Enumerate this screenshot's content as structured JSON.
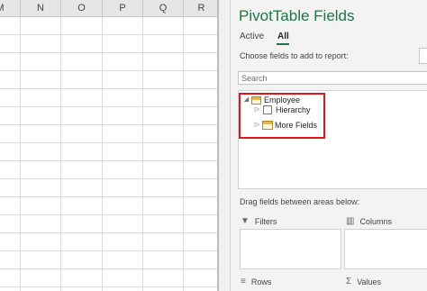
{
  "sheet": {
    "columns": [
      "M",
      "N",
      "O",
      "P",
      "Q",
      "R"
    ]
  },
  "pane": {
    "title": "PivotTable Fields",
    "tabs": [
      {
        "label": "Active"
      },
      {
        "label": "All"
      }
    ],
    "choose_label": "Choose fields to add to report:",
    "search_placeholder": "Search",
    "fields": {
      "table_name": "Employee",
      "items": [
        "Hierarchy",
        "More Fields"
      ]
    },
    "drag_label": "Drag fields between areas below:",
    "areas": {
      "filters": "Filters",
      "columns": "Columns",
      "rows": "Rows",
      "values": "Values"
    },
    "highlight_color": "#e0161c",
    "accent_color": "#217346"
  },
  "icons": [
    "table-icon",
    "checkbox-icon",
    "more-fields-icon",
    "filter-icon",
    "columns-icon",
    "rows-icon",
    "sigma-icon",
    "expand-arrow-icon"
  ]
}
